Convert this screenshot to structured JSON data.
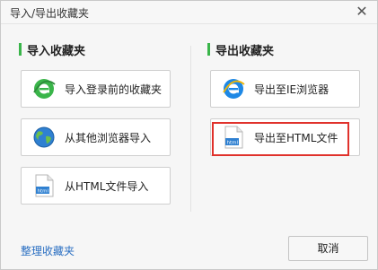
{
  "window": {
    "title": "导入/导出收藏夹",
    "close_glyph": "✕"
  },
  "import": {
    "title": "导入收藏夹",
    "buttons": [
      {
        "label": "导入登录前的收藏夹",
        "icon": "green-ie-icon"
      },
      {
        "label": "从其他浏览器导入",
        "icon": "globe-icon"
      },
      {
        "label": "从HTML文件导入",
        "icon": "html-file-icon"
      }
    ]
  },
  "export": {
    "title": "导出收藏夹",
    "buttons": [
      {
        "label": "导出至IE浏览器",
        "icon": "ie-icon"
      },
      {
        "label": "导出至HTML文件",
        "icon": "html-file-icon",
        "highlighted": true
      }
    ]
  },
  "footer": {
    "manage_link": "整理收藏夹",
    "cancel_label": "取消"
  },
  "colors": {
    "accent_green": "#3ab54a",
    "ie_blue": "#1e88e5",
    "highlight_red": "#e0322c",
    "link_blue": "#2a6fc2"
  }
}
